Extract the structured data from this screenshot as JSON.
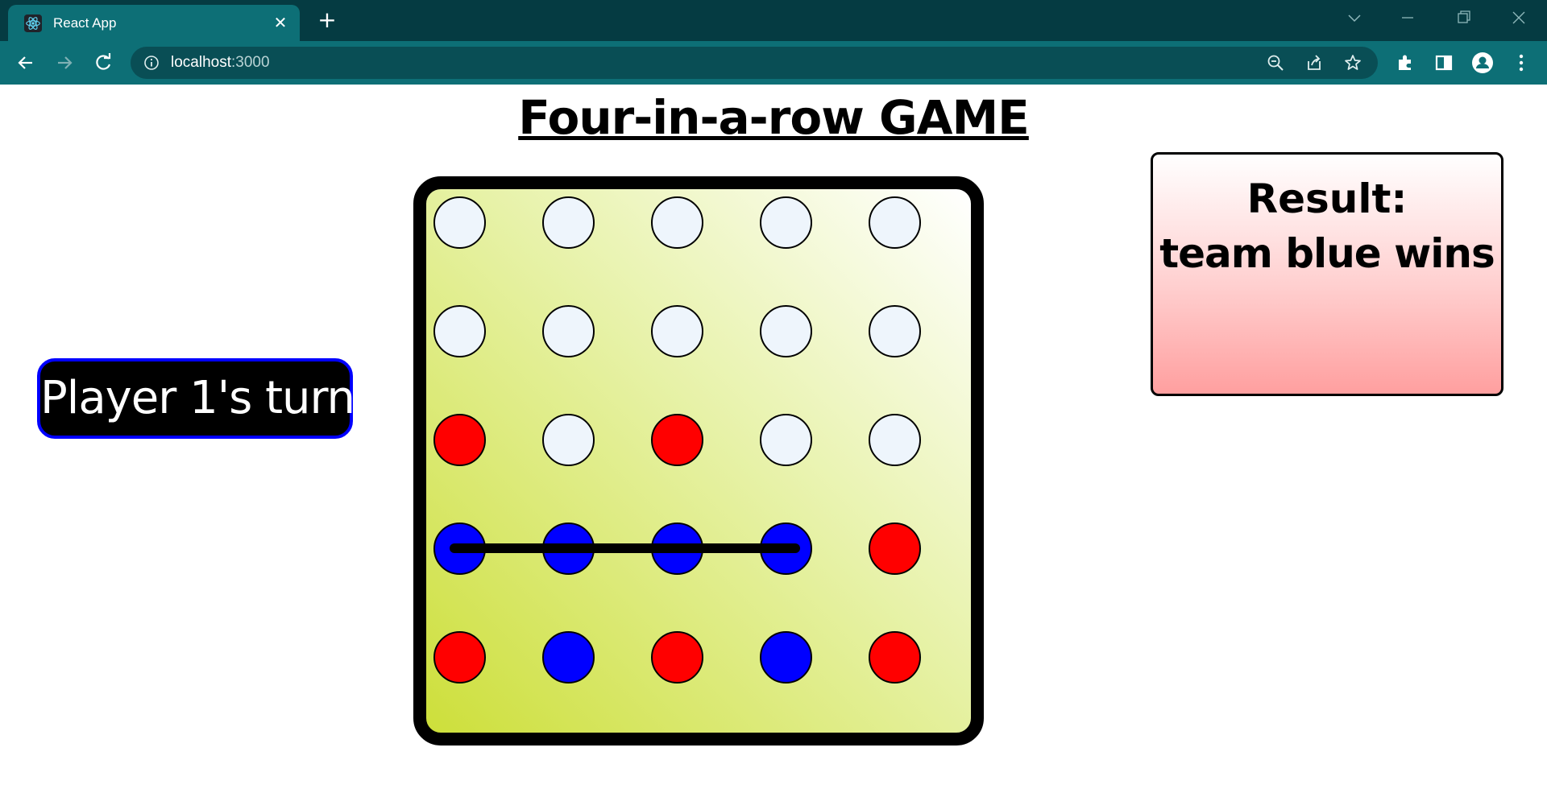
{
  "browser": {
    "tab_title": "React App",
    "url_host": "localhost",
    "url_port": ":3000",
    "icons": [
      "react-favicon",
      "close-icon",
      "plus-icon",
      "chevron-down-icon",
      "minimize-icon",
      "restore-icon",
      "window-close-icon",
      "back-arrow-icon",
      "forward-arrow-icon",
      "reload-icon",
      "info-icon",
      "zoom-out-icon",
      "share-icon",
      "star-icon",
      "extensions-icon",
      "side-panel-icon",
      "profile-icon",
      "more-vert-icon"
    ]
  },
  "page": {
    "title": "Four-in-a-row GAME",
    "turn_text": "Player 1's turn",
    "result_label": "Result:",
    "result_text": "team blue wins"
  },
  "colors": {
    "empty": "#eef5fc",
    "red": "#ff0000",
    "blue": "#0000ff",
    "board_border": "#000000",
    "turn_border": "#0000ff"
  },
  "board": {
    "rows": 5,
    "cols": 5,
    "cells": [
      [
        "empty",
        "empty",
        "empty",
        "empty",
        "empty"
      ],
      [
        "empty",
        "empty",
        "empty",
        "empty",
        "empty"
      ],
      [
        "red",
        "empty",
        "red",
        "empty",
        "empty"
      ],
      [
        "blue",
        "blue",
        "blue",
        "blue",
        "red"
      ],
      [
        "red",
        "blue",
        "red",
        "blue",
        "red"
      ]
    ],
    "winning_line": {
      "row": 3,
      "from_col": 0,
      "to_col": 3
    }
  }
}
